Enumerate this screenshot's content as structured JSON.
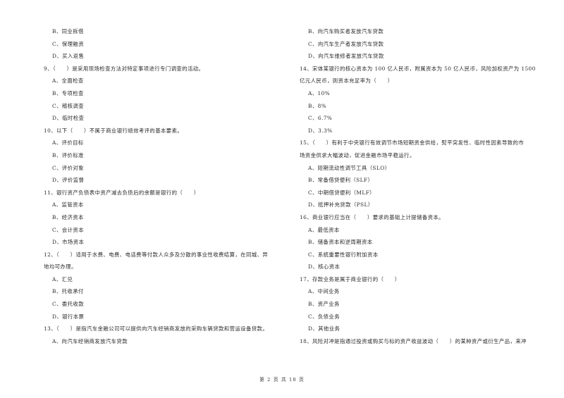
{
  "left_column": [
    {
      "type": "opt",
      "text": "B、同业拆借"
    },
    {
      "type": "opt",
      "text": "C、保理融资"
    },
    {
      "type": "opt",
      "text": "D、买入返售"
    },
    {
      "type": "q",
      "text": "9、（　　）是采用现场检查方法对特定事项进行专门调查的活动。"
    },
    {
      "type": "opt",
      "text": "A、全面检查"
    },
    {
      "type": "opt",
      "text": "B、专项检查"
    },
    {
      "type": "opt",
      "text": "C、稽核调查"
    },
    {
      "type": "opt",
      "text": "D、临时检查"
    },
    {
      "type": "q",
      "text": "10、以下（　　）不属于商业银行绩效考评的基本要素。"
    },
    {
      "type": "opt",
      "text": "A、评价目标"
    },
    {
      "type": "opt",
      "text": "B、评价标准"
    },
    {
      "type": "opt",
      "text": "C、评价对象"
    },
    {
      "type": "opt",
      "text": "D、评价监督"
    },
    {
      "type": "q",
      "text": "11、银行资产负债表中资产减去负债后的余额是银行的（　　）"
    },
    {
      "type": "opt",
      "text": "A、监管资本"
    },
    {
      "type": "opt",
      "text": "B、经济资本"
    },
    {
      "type": "opt",
      "text": "C、会计资本"
    },
    {
      "type": "opt",
      "text": "D、市场资本"
    },
    {
      "type": "q",
      "text": "12、（　　）适用于水费、电费、电话费等付款人众多及分散的事业性收费结算，在同城、异"
    },
    {
      "type": "cont",
      "text": "地均可办理。"
    },
    {
      "type": "opt",
      "text": "A、汇兑"
    },
    {
      "type": "opt",
      "text": "B、托收承付"
    },
    {
      "type": "opt",
      "text": "C、委托收款"
    },
    {
      "type": "opt",
      "text": "D、银行本票"
    },
    {
      "type": "q",
      "text": "13、（　　）是指汽车金融公司可以提供向汽车经销商发放的采购车辆贷款和营运设备贷款。"
    },
    {
      "type": "opt",
      "text": "A、向汽车经销商发放汽车贷款"
    }
  ],
  "right_column": [
    {
      "type": "opt",
      "text": "B、向汽车购买者发放汽车贷款"
    },
    {
      "type": "opt",
      "text": "C、向汽车生产者发放汽车贷款"
    },
    {
      "type": "opt",
      "text": "D、向汽车维修者发放汽车贷款"
    },
    {
      "type": "q",
      "text": "14、宋体某银行的核心资本为 100 亿人民币，附属资本为 50 亿人民币，风险加权资产为 1500"
    },
    {
      "type": "cont",
      "text": "亿元人民币，则资本充足率为（　　）"
    },
    {
      "type": "opt",
      "text": "A、10%"
    },
    {
      "type": "opt",
      "text": "B、8%"
    },
    {
      "type": "opt",
      "text": "C、6.7%"
    },
    {
      "type": "opt",
      "text": "D、3.3%"
    },
    {
      "type": "q",
      "text": "15、（　　）有利于中央银行有效调节市场短期资金供给，熨平突发性、临时性因素导致的市"
    },
    {
      "type": "cont",
      "text": "场资金供求大幅波动，促进金融市场平稳运行。"
    },
    {
      "type": "opt",
      "text": "A、短期流动性调节工具（SLO）"
    },
    {
      "type": "opt",
      "text": "B、常备借贷便利（SLF）"
    },
    {
      "type": "opt",
      "text": "C、中期借贷便利（MLF）"
    },
    {
      "type": "opt",
      "text": "D、抵押补充贷款（PSL）"
    },
    {
      "type": "q",
      "text": "16、商业银行应当在（　　）要求的基础上计提储备资本。"
    },
    {
      "type": "opt",
      "text": "A、最低资本"
    },
    {
      "type": "opt",
      "text": "B、储备资本和逆周期资本"
    },
    {
      "type": "opt",
      "text": "C、系统重要性银行附加资本"
    },
    {
      "type": "opt",
      "text": "D、核心资本"
    },
    {
      "type": "q",
      "text": "17、存款业务是属于商业银行的（　　）"
    },
    {
      "type": "opt",
      "text": "A、中间业务"
    },
    {
      "type": "opt",
      "text": "B、资产业务"
    },
    {
      "type": "opt",
      "text": "C、负债业务"
    },
    {
      "type": "opt",
      "text": "D、其他业务"
    },
    {
      "type": "q",
      "text": "18、风险对冲是指通过投资或购买与标的资产收益波动（　　）的某种资产或衍生产品，来冲"
    }
  ],
  "footer": {
    "page_label": "第 2 页 共 18 页"
  }
}
